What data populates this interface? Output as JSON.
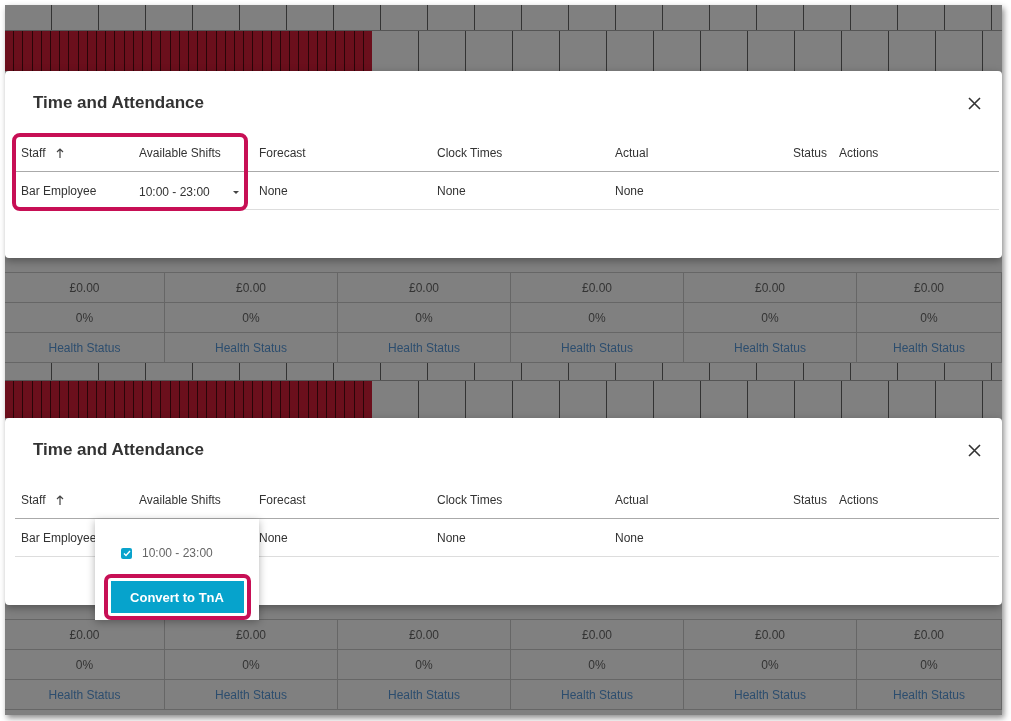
{
  "panels": [
    {
      "dialog": {
        "title": "Time and Attendance",
        "columns": [
          {
            "label": "Staff",
            "sorted": true
          },
          {
            "label": "Available Shifts",
            "sorted": false
          },
          {
            "label": "Forecast",
            "sorted": false
          },
          {
            "label": "Clock Times",
            "sorted": false
          },
          {
            "label": "Actual",
            "sorted": false
          },
          {
            "label": "Status",
            "sorted": false
          },
          {
            "label": "Actions",
            "sorted": false
          }
        ],
        "row": {
          "staff": "Bar Employee",
          "shift_select": "10:00 - 23:00",
          "forecast": "None",
          "clock_times": "None",
          "actual": "None"
        },
        "highlighted": true
      },
      "summary": [
        {
          "amount": "£0.00",
          "percent": "0%",
          "link": "Health Status"
        },
        {
          "amount": "£0.00",
          "percent": "0%",
          "link": "Health Status"
        },
        {
          "amount": "£0.00",
          "percent": "0%",
          "link": "Health Status"
        },
        {
          "amount": "£0.00",
          "percent": "0%",
          "link": "Health Status"
        },
        {
          "amount": "£0.00",
          "percent": "0%",
          "link": "Health Status"
        },
        {
          "amount": "£0.00",
          "percent": "0%",
          "link": "Health Status"
        }
      ]
    },
    {
      "dialog": {
        "title": "Time and Attendance",
        "columns": [
          {
            "label": "Staff",
            "sorted": true
          },
          {
            "label": "Available Shifts",
            "sorted": false
          },
          {
            "label": "Forecast",
            "sorted": false
          },
          {
            "label": "Clock Times",
            "sorted": false
          },
          {
            "label": "Actual",
            "sorted": false
          },
          {
            "label": "Status",
            "sorted": false
          },
          {
            "label": "Actions",
            "sorted": false
          }
        ],
        "row": {
          "staff": "Bar Employee",
          "forecast": "None",
          "clock_times": "None",
          "actual": "None"
        }
      },
      "shift_menu": {
        "options": [
          {
            "label": "10:00 - 23:00",
            "checked": true
          }
        ],
        "button": {
          "label": "Convert to TnA",
          "highlighted": true
        }
      },
      "summary": [
        {
          "amount": "£0.00",
          "percent": "0%",
          "link": "Health Status"
        },
        {
          "amount": "£0.00",
          "percent": "0%",
          "link": "Health Status"
        },
        {
          "amount": "£0.00",
          "percent": "0%",
          "link": "Health Status"
        },
        {
          "amount": "£0.00",
          "percent": "0%",
          "link": "Health Status"
        },
        {
          "amount": "£0.00",
          "percent": "0%",
          "link": "Health Status"
        },
        {
          "amount": "£0.00",
          "percent": "0%",
          "link": "Health Status"
        }
      ]
    }
  ]
}
